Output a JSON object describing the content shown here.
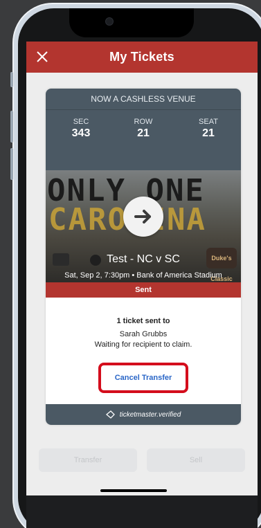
{
  "header": {
    "title": "My Tickets"
  },
  "ticket": {
    "banner": "NOW A CASHLESS VENUE",
    "seat": {
      "sec_label": "SEC",
      "sec_value": "343",
      "row_label": "ROW",
      "row_value": "21",
      "seat_label": "SEAT",
      "seat_value": "21"
    },
    "event": {
      "image_text_line1": "ONLY ONE",
      "image_text_line2": "CAROLINA",
      "title": "Test - NC v SC",
      "subtitle": "Sat, Sep 2, 7:30pm • Bank of America Stadium",
      "sponsor_logo_text": "Duke's Classic"
    },
    "status": "Sent",
    "transfer": {
      "heading": "1 ticket sent to",
      "recipient": "Sarah Grubbs",
      "waiting": "Waiting for recipient to claim.",
      "cancel_label": "Cancel Transfer"
    },
    "verified": "ticketmaster.verified"
  },
  "actions": {
    "transfer_label": "Transfer",
    "sell_label": "Sell"
  },
  "colors": {
    "header": "#b3352f",
    "card_panel": "#4b5964",
    "highlight_outline": "#d40d1c",
    "link_blue": "#2a66c7",
    "background": "#3a3b3d"
  }
}
